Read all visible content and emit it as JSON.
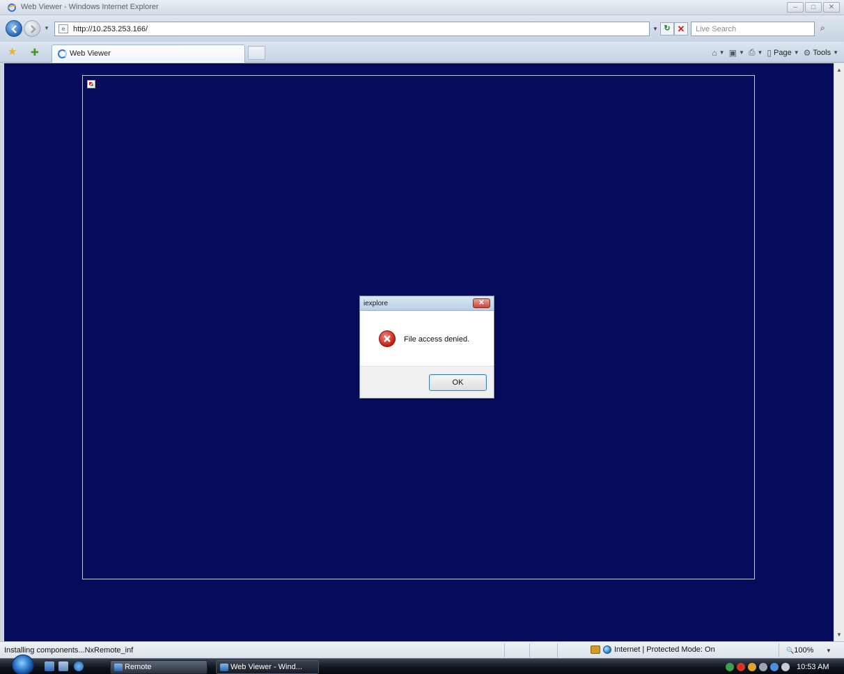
{
  "window": {
    "title": "Web Viewer - Windows Internet Explorer",
    "controls": [
      "–",
      "□",
      "✕"
    ]
  },
  "address_bar": {
    "url": "http://10.253.253.166/",
    "search_placeholder": "Live Search",
    "refresh_glyph": "↻",
    "stop_glyph": "✕",
    "search_glyph": "⌕"
  },
  "tabs": [
    {
      "label": "Web Viewer",
      "active": true
    }
  ],
  "command_bar": {
    "home_glyph": "⌂",
    "feeds_glyph": "▣",
    "print_glyph": "⎙",
    "page_label": "Page",
    "tools_label": "Tools",
    "dropdown_glyph": "▼"
  },
  "dialog": {
    "title": "iexplore",
    "close_glyph": "✕",
    "message": "File access denied.",
    "ok_label": "OK",
    "icon": "error-icon"
  },
  "status_bar": {
    "text": "Installing components...NxRemote_inf",
    "zone": "Internet | Protected Mode: On",
    "zoom": "100%",
    "zoom_glyph": "🔍"
  },
  "taskbar": {
    "buttons": [
      {
        "label": "Remote"
      },
      {
        "label": "Web Viewer - Wind..."
      }
    ],
    "clock": "10:53 AM"
  },
  "colors": {
    "content_background": "#070b5c",
    "frame_border": "#c7cbe3",
    "error_red": "#c41c10"
  }
}
